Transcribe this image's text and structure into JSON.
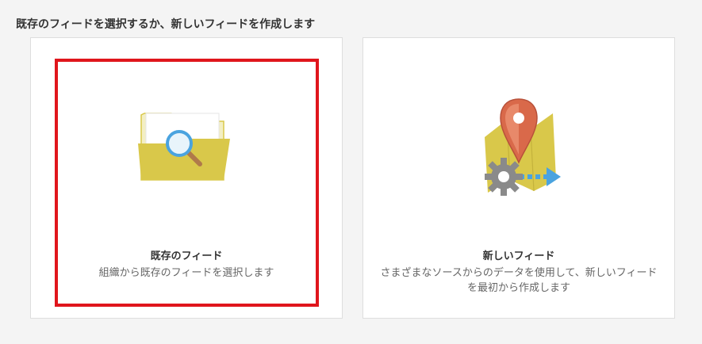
{
  "prompt": "既存のフィードを選択するか、新しいフィードを作成します",
  "cards": [
    {
      "id": "existing",
      "title": "既存のフィード",
      "description_lines": [
        "組織から既存のフィードを選択します"
      ],
      "icon": "folder-search-icon",
      "selected": true
    },
    {
      "id": "new",
      "title": "新しいフィード",
      "description_lines": [
        "さまざまなソースからのデータを使用して、新しいフィード",
        "を最初から作成します"
      ],
      "icon": "map-pin-gear-arrow-icon",
      "selected": false
    }
  ],
  "colors": {
    "selection_outline": "#e0161c",
    "folder": "#d9c84a",
    "pin": "#d9694a",
    "gear": "#8a8a8a",
    "arrow": "#4aa3df"
  }
}
